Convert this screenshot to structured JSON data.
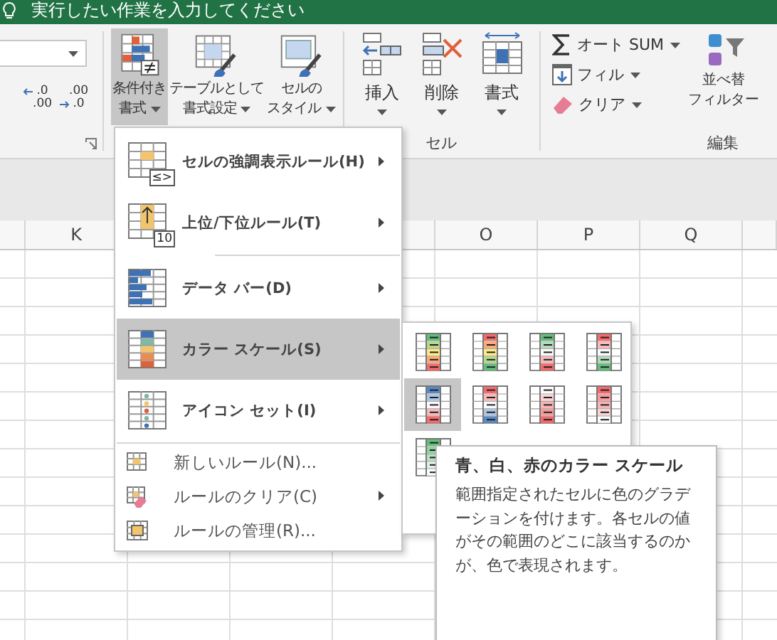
{
  "title_bar": {
    "search_prompt": "実行したい作業を入力してください"
  },
  "ribbon": {
    "number": {
      "decimal_buttons": [
        {
          "top": ".0",
          "bottom": ".00"
        },
        {
          "top": ".00",
          "bottom": ".0"
        }
      ]
    },
    "styles": [
      {
        "kind": "conditional",
        "lines": [
          "条件付き",
          "書式"
        ],
        "selected": true
      },
      {
        "kind": "table",
        "lines": [
          "テーブルとして",
          "書式設定"
        ],
        "selected": false
      },
      {
        "kind": "cell_style",
        "lines": [
          "セルの",
          "スタイル"
        ],
        "selected": false
      }
    ],
    "cells": {
      "label": "セル",
      "buttons": [
        {
          "kind": "insert",
          "label": "挿入"
        },
        {
          "kind": "delete",
          "label": "削除"
        },
        {
          "kind": "format",
          "label": "書式"
        }
      ]
    },
    "editing": {
      "label": "編集",
      "items": [
        {
          "kind": "autosum",
          "label": "オート SUM"
        },
        {
          "kind": "fill",
          "label": "フィル"
        },
        {
          "kind": "clear",
          "label": "クリア"
        }
      ],
      "sort_lines": [
        "並べ替",
        "フィルター"
      ]
    }
  },
  "columns": [
    {},
    {
      "label": "K"
    },
    {},
    {},
    {},
    {
      "label": "O"
    },
    {
      "label": "P"
    },
    {
      "label": "Q"
    },
    {}
  ],
  "menu": {
    "items": [
      {
        "kind": "large",
        "label": "セルの強調表示ルール(H)",
        "badge": "≤>",
        "has_submenu": true,
        "selected": false
      },
      {
        "kind": "large",
        "label": "上位/下位ルール(T)",
        "badge": "10",
        "has_submenu": true,
        "selected": false
      },
      {
        "kind": "separator",
        "inset": true
      },
      {
        "kind": "large",
        "label": "データ バー(D)",
        "has_submenu": true,
        "selected": false
      },
      {
        "kind": "large",
        "label": "カラー スケール(S)",
        "has_submenu": true,
        "selected": true
      },
      {
        "kind": "large",
        "label": "アイコン セット(I)",
        "has_submenu": true,
        "selected": false
      },
      {
        "kind": "separator",
        "inset": false
      },
      {
        "kind": "small",
        "label": "新しいルール(N)...",
        "has_submenu": false,
        "selected": false
      },
      {
        "kind": "small",
        "label": "ルールのクリア(C)",
        "has_submenu": true,
        "selected": false
      },
      {
        "kind": "small",
        "label": "ルールの管理(R)...",
        "has_submenu": false,
        "selected": false
      }
    ]
  },
  "color_scales": [
    {
      "rows": [
        {
          "color": "#63be7b"
        },
        {
          "color": "#b5d88a"
        },
        {
          "color": "#ffeb84"
        },
        {
          "color": "#fbaa77"
        },
        {
          "color": "#f8696b"
        }
      ],
      "selected": false
    },
    {
      "rows": [
        {
          "color": "#f8696b"
        },
        {
          "color": "#fbaa77"
        },
        {
          "color": "#ffeb84"
        },
        {
          "color": "#b5d88a"
        },
        {
          "color": "#63be7b"
        }
      ],
      "selected": false
    },
    {
      "rows": [
        {
          "color": "#63be7b"
        },
        {
          "color": "#b1dcb9"
        },
        {
          "color": "#fcfcff"
        },
        {
          "color": "#f8b9bb"
        },
        {
          "color": "#f8696b"
        }
      ],
      "selected": false
    },
    {
      "rows": [
        {
          "color": "#f8696b"
        },
        {
          "color": "#f8b9bb"
        },
        {
          "color": "#fcfcff"
        },
        {
          "color": "#b1dcb9"
        },
        {
          "color": "#63be7b"
        }
      ],
      "selected": false
    },
    {
      "rows": [
        {
          "color": "#5a8ac6"
        },
        {
          "color": "#acc4e3"
        },
        {
          "color": "#fcfcff"
        },
        {
          "color": "#f9b7b8"
        },
        {
          "color": "#f8696b"
        }
      ],
      "selected": true
    },
    {
      "rows": [
        {
          "color": "#f8696b"
        },
        {
          "color": "#f9b7b8"
        },
        {
          "color": "#fcfcff"
        },
        {
          "color": "#acc4e3"
        },
        {
          "color": "#5a8ac6"
        }
      ],
      "selected": false
    },
    {
      "rows": [
        {
          "color": "#fcfcff"
        },
        {
          "color": "#fad4d5"
        },
        {
          "color": "#f9b5b6"
        },
        {
          "color": "#f8999a"
        },
        {
          "color": "#f8696b"
        }
      ],
      "selected": false
    },
    {
      "rows": [
        {
          "color": "#f8696b"
        },
        {
          "color": "#f8999a"
        },
        {
          "color": "#f9b5b6"
        },
        {
          "color": "#fad4d5"
        },
        {
          "color": "#fcfcff"
        }
      ],
      "selected": false
    },
    {
      "rows": [
        {
          "color": "#63be7b"
        },
        {
          "color": "#8fd09f"
        },
        {
          "color": "#bbe1c5"
        },
        {
          "color": "#dff0e3"
        },
        {
          "color": "#fcfcff"
        }
      ],
      "selected": false
    }
  ],
  "tooltip": {
    "title": "青、白、赤のカラー スケール",
    "text": "範囲指定されたセルに色のグラデーションを付けます。各セルの値がその範囲のどこに該当するのかが、色で表現されます。"
  }
}
